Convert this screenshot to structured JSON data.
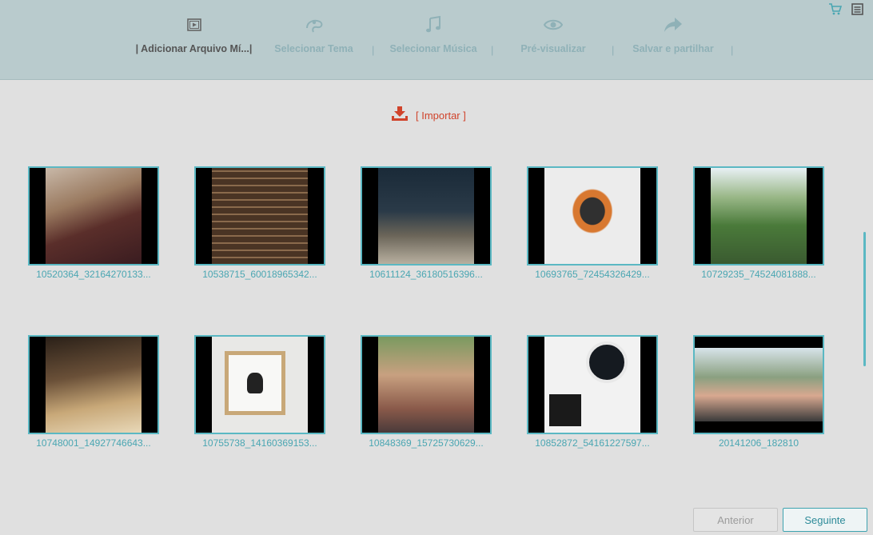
{
  "steps": [
    {
      "label": "| Adicionar Arquivo Mí...|",
      "icon": "play-frame-icon",
      "active": true
    },
    {
      "label": "Selecionar Tema",
      "icon": "theme-icon",
      "active": false
    },
    {
      "label": "Selecionar Música",
      "icon": "music-note-icon",
      "active": false
    },
    {
      "label": "Pré-visualizar",
      "icon": "eye-icon",
      "active": false
    },
    {
      "label": "Salvar e partilhar",
      "icon": "share-arrow-icon",
      "active": false
    }
  ],
  "separators": [
    "|",
    "|",
    "|",
    "|"
  ],
  "header_icons": [
    "cart-icon",
    "menu-icon"
  ],
  "import": {
    "label": "[ Importar ]",
    "icon": "download-icon"
  },
  "media": [
    {
      "caption": "10520364_32164270133..."
    },
    {
      "caption": "10538715_60018965342..."
    },
    {
      "caption": "10611124_36180516396..."
    },
    {
      "caption": "10693765_72454326429..."
    },
    {
      "caption": "10729235_74524081888..."
    },
    {
      "caption": "10748001_14927746643..."
    },
    {
      "caption": "10755738_14160369153..."
    },
    {
      "caption": "10848369_15725730629..."
    },
    {
      "caption": "10852872_54161227597..."
    },
    {
      "caption": "20141206_182810"
    }
  ],
  "buttons": {
    "prev": "Anterior",
    "next": "Seguinte"
  },
  "colors": {
    "accent": "#5bb8c3",
    "header_bg": "#b9cbcd",
    "import": "#d0432b"
  }
}
